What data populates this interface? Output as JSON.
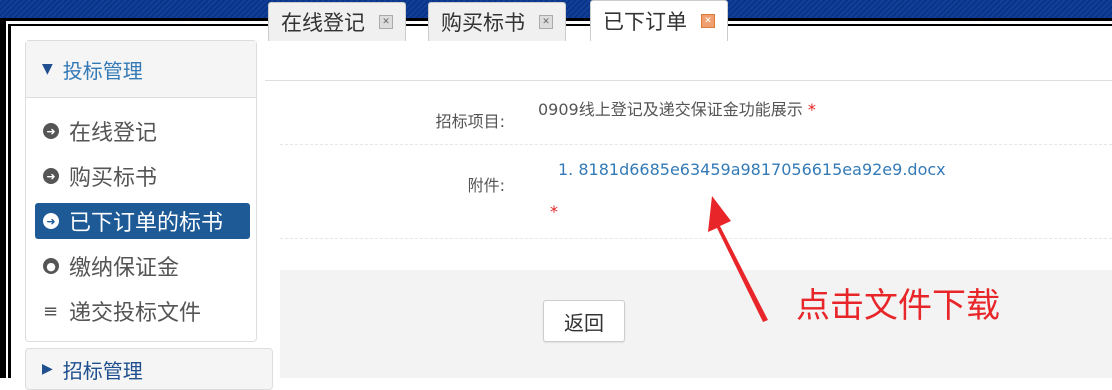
{
  "sidebar": {
    "header": "投标管理",
    "items": [
      {
        "label": "在线登记",
        "icon": "arrow-circle-right-icon"
      },
      {
        "label": "购买标书",
        "icon": "arrow-circle-right-icon"
      },
      {
        "label": "已下订单的标书",
        "icon": "arrow-circle-right-icon"
      },
      {
        "label": "缴纳保证金",
        "icon": "globe-icon"
      },
      {
        "label": "递交投标文件",
        "icon": "list-icon"
      }
    ],
    "next_section": "招标管理"
  },
  "tabs": [
    {
      "label": "在线登记"
    },
    {
      "label": "购买标书"
    },
    {
      "label": "已下订单"
    }
  ],
  "form": {
    "project_label": "招标项目:",
    "project_value": "0909线上登记及递交保证金功能展示",
    "attachment_label": "附件:",
    "attachment_link": "1. 8181d6685e63459a9817056615ea92e9.docx",
    "required_mark": "*"
  },
  "buttons": {
    "back": "返回"
  },
  "annotation": {
    "text": "点击文件下载",
    "color": "#e8262a"
  },
  "colors": {
    "active_item": "#1d5a96",
    "link": "#337ab7",
    "header_bar": "#0b3d91"
  }
}
